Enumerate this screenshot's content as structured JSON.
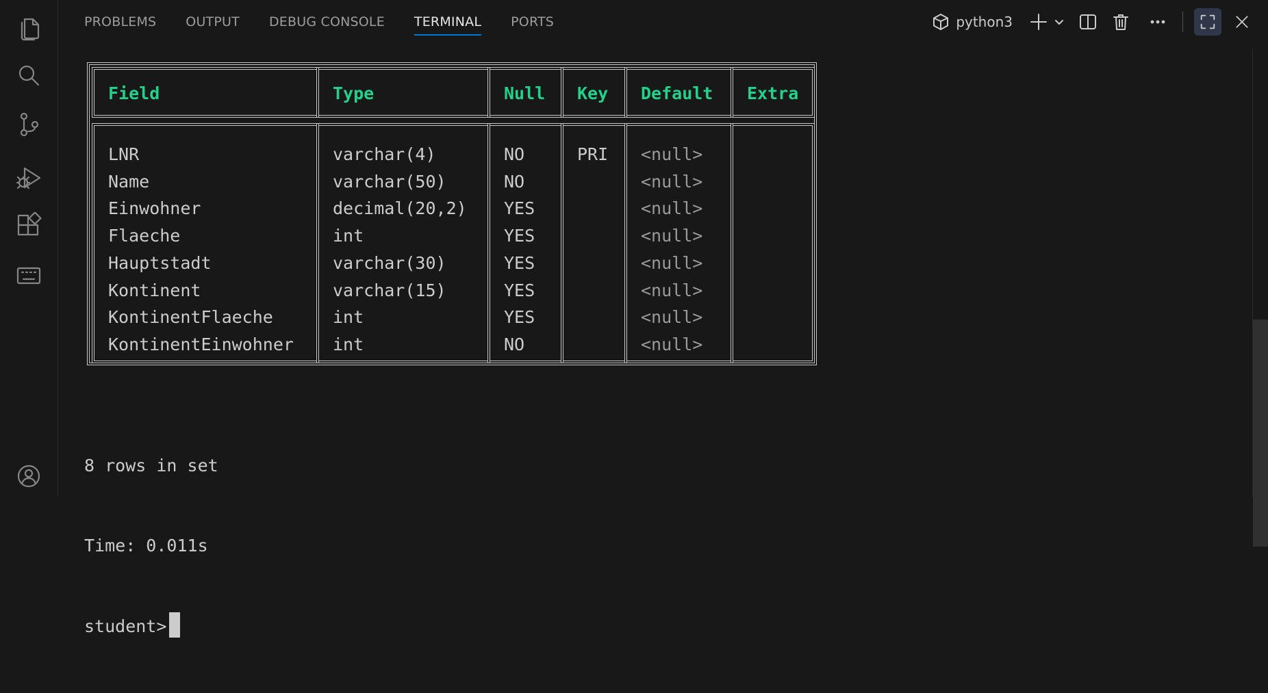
{
  "activity_bar": {
    "icons": [
      "explorer-icon",
      "search-icon",
      "source-control-icon",
      "run-debug-icon",
      "extensions-icon",
      "remote-keyboard-icon",
      "account-icon"
    ]
  },
  "panel": {
    "tabs": [
      {
        "label": "PROBLEMS"
      },
      {
        "label": "OUTPUT"
      },
      {
        "label": "DEBUG CONSOLE"
      },
      {
        "label": "TERMINAL",
        "active": true
      },
      {
        "label": "PORTS"
      }
    ],
    "terminal_name": "python3",
    "accent_color": "#0078d4"
  },
  "terminal": {
    "headers": [
      "Field",
      "Type",
      "Null",
      "Key",
      "Default",
      "Extra"
    ],
    "columns": {
      "field": "LNR\nName\nEinwohner\nFlaeche\nHauptstadt\nKontinent\nKontinentFlaeche\nKontinentEinwohner",
      "type": "varchar(4)\nvarchar(50)\ndecimal(20,2)\nint\nvarchar(30)\nvarchar(15)\nint\nint",
      "null": "NO\nNO\nYES\nYES\nYES\nYES\nYES\nNO",
      "key": "PRI",
      "default": "<null>\n<null>\n<null>\n<null>\n<null>\n<null>\n<null>\n<null>",
      "extra": ""
    },
    "rows_info": "8 rows in set",
    "time_info": "Time: 0.011s",
    "prompt": "student>",
    "header_color": "#23d18b"
  }
}
